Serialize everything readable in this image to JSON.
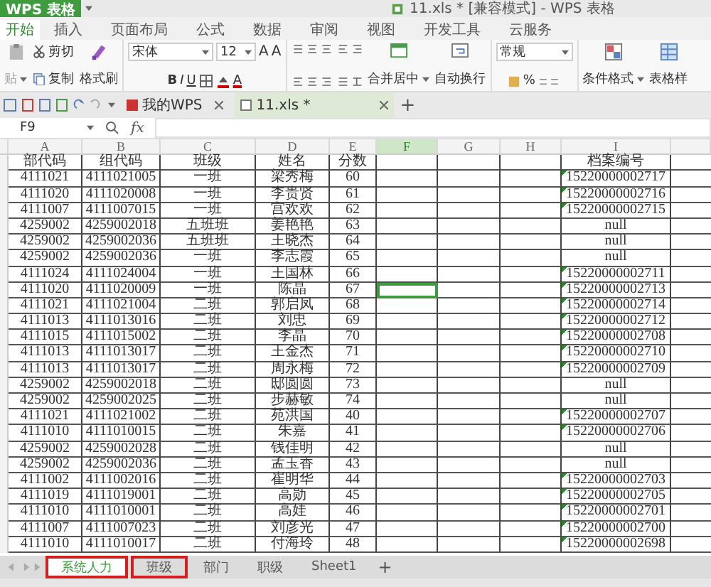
{
  "app_button": {
    "label": "WPS 表格"
  },
  "window": {
    "title": "11.xls * [兼容模式] - WPS 表格"
  },
  "menu_tabs": [
    {
      "label": "开始",
      "selected": true
    },
    {
      "label": "插入",
      "selected": false
    },
    {
      "label": "页面布局",
      "selected": false
    },
    {
      "label": "公式",
      "selected": false
    },
    {
      "label": "数据",
      "selected": false
    },
    {
      "label": "审阅",
      "selected": false
    },
    {
      "label": "视图",
      "selected": false
    },
    {
      "label": "开发工具",
      "selected": false
    },
    {
      "label": "云服务",
      "selected": false
    }
  ],
  "ribbon": {
    "paste": "贴",
    "cut": "剪切",
    "copy": "复制",
    "format_painter": "格式刷",
    "font_name": "宋体",
    "font_size": "12",
    "grow_font": "A",
    "shrink_font": "A",
    "bold": "B",
    "italic": "I",
    "underline": "U",
    "font_color": "A",
    "merge": "合并居中",
    "wrap": "自动换行",
    "number_format": "常规",
    "percent": "%",
    "conditional_format": "条件格式",
    "table_style": "表格样"
  },
  "doc_tabs": [
    {
      "label": "我的WPS",
      "selected": false
    },
    {
      "label": "11.xls *",
      "selected": true
    }
  ],
  "new_tab": "+",
  "formula_bar": {
    "cell_ref": "F9",
    "fx": "fx"
  },
  "columns": [
    {
      "label": "A",
      "selected": false
    },
    {
      "label": "B",
      "selected": false
    },
    {
      "label": "C",
      "selected": false
    },
    {
      "label": "D",
      "selected": false
    },
    {
      "label": "E",
      "selected": false
    },
    {
      "label": "F",
      "selected": true
    },
    {
      "label": "G",
      "selected": false
    },
    {
      "label": "H",
      "selected": false
    },
    {
      "label": "I",
      "selected": false
    }
  ],
  "header": {
    "dept": "部代码",
    "group": "组代码",
    "class": "班级",
    "name": "姓名",
    "score": "分数",
    "file_no": "档案编号"
  },
  "rows": [
    {
      "dept": "4111021",
      "group": "4111021005",
      "class": "一班",
      "name": "梁秀梅",
      "score": "60",
      "file_no": "15220000002717",
      "flag": true,
      "f_selected": false
    },
    {
      "dept": "4111020",
      "group": "4111020008",
      "class": "一班",
      "name": "李贵贤",
      "score": "61",
      "file_no": "15220000002716",
      "flag": true,
      "f_selected": false
    },
    {
      "dept": "4111007",
      "group": "4111007015",
      "class": "一班",
      "name": "宫欢欢",
      "score": "62",
      "file_no": "15220000002715",
      "flag": true,
      "f_selected": false
    },
    {
      "dept": "4259002",
      "group": "4259002018",
      "class": "五班班",
      "name": "姜艳艳",
      "score": "63",
      "file_no": "null",
      "flag": false,
      "f_selected": false
    },
    {
      "dept": "4259002",
      "group": "4259002036",
      "class": "五班班",
      "name": "王晓杰",
      "score": "64",
      "file_no": "null",
      "flag": false,
      "f_selected": false
    },
    {
      "dept": "4259002",
      "group": "4259002036",
      "class": "一班",
      "name": "李志霞",
      "score": "65",
      "file_no": "null",
      "flag": false,
      "f_selected": false
    },
    {
      "dept": "4111024",
      "group": "4111024004",
      "class": "一班",
      "name": "王国林",
      "score": "66",
      "file_no": "15220000002711",
      "flag": true,
      "f_selected": false
    },
    {
      "dept": "4111020",
      "group": "4111020009",
      "class": "一班",
      "name": "陈晶",
      "score": "67",
      "file_no": "15220000002713",
      "flag": true,
      "f_selected": true
    },
    {
      "dept": "4111021",
      "group": "4111021004",
      "class": "二班",
      "name": "郭启凤",
      "score": "68",
      "file_no": "15220000002714",
      "flag": true,
      "f_selected": false
    },
    {
      "dept": "4111013",
      "group": "4111013016",
      "class": "二班",
      "name": "刘忠",
      "score": "69",
      "file_no": "15220000002712",
      "flag": true,
      "f_selected": false
    },
    {
      "dept": "4111015",
      "group": "4111015002",
      "class": "二班",
      "name": "李晶",
      "score": "70",
      "file_no": "15220000002708",
      "flag": true,
      "f_selected": false
    },
    {
      "dept": "4111013",
      "group": "4111013017",
      "class": "二班",
      "name": "王金杰",
      "score": "71",
      "file_no": "15220000002710",
      "flag": true,
      "f_selected": false
    },
    {
      "dept": "4111013",
      "group": "4111013017",
      "class": "二班",
      "name": "周永梅",
      "score": "72",
      "file_no": "15220000002709",
      "flag": true,
      "f_selected": false
    },
    {
      "dept": "4259002",
      "group": "4259002018",
      "class": "二班",
      "name": "邸圆圆",
      "score": "73",
      "file_no": "null",
      "flag": false,
      "f_selected": false
    },
    {
      "dept": "4259002",
      "group": "4259002025",
      "class": "二班",
      "name": "步赫敏",
      "score": "74",
      "file_no": "null",
      "flag": false,
      "f_selected": false
    },
    {
      "dept": "4111021",
      "group": "4111021002",
      "class": "二班",
      "name": "苑洪国",
      "score": "40",
      "file_no": "15220000002707",
      "flag": true,
      "f_selected": false
    },
    {
      "dept": "4111010",
      "group": "4111010015",
      "class": "二班",
      "name": "朱嘉",
      "score": "41",
      "file_no": "15220000002706",
      "flag": true,
      "f_selected": false
    },
    {
      "dept": "4259002",
      "group": "4259002028",
      "class": "二班",
      "name": "钱佳明",
      "score": "42",
      "file_no": "null",
      "flag": false,
      "f_selected": false
    },
    {
      "dept": "4259002",
      "group": "4259002036",
      "class": "二班",
      "name": "孟玉香",
      "score": "43",
      "file_no": "null",
      "flag": false,
      "f_selected": false
    },
    {
      "dept": "4111002",
      "group": "4111002016",
      "class": "二班",
      "name": "崔明华",
      "score": "44",
      "file_no": "15220000002703",
      "flag": true,
      "f_selected": false
    },
    {
      "dept": "4111019",
      "group": "4111019001",
      "class": "二班",
      "name": "高勋",
      "score": "45",
      "file_no": "15220000002705",
      "flag": true,
      "f_selected": false
    },
    {
      "dept": "4111010",
      "group": "4111010001",
      "class": "二班",
      "name": "高娃",
      "score": "46",
      "file_no": "15220000002701",
      "flag": true,
      "f_selected": false
    },
    {
      "dept": "4111007",
      "group": "4111007023",
      "class": "二班",
      "name": "刘彦光",
      "score": "47",
      "file_no": "15220000002700",
      "flag": true,
      "f_selected": false
    },
    {
      "dept": "4111010",
      "group": "4111010017",
      "class": "二班",
      "name": "付海玲",
      "score": "48",
      "file_no": "15220000002698",
      "flag": true,
      "f_selected": false
    }
  ],
  "sheet_tabs": [
    {
      "label": "系统人力",
      "selected": true,
      "highlighted": true
    },
    {
      "label": "班级",
      "selected": false,
      "highlighted": true
    },
    {
      "label": "部门",
      "selected": false,
      "highlighted": false
    },
    {
      "label": "职级",
      "selected": false,
      "highlighted": false
    },
    {
      "label": "Sheet1",
      "selected": false,
      "highlighted": false
    }
  ],
  "add_sheet": "+"
}
